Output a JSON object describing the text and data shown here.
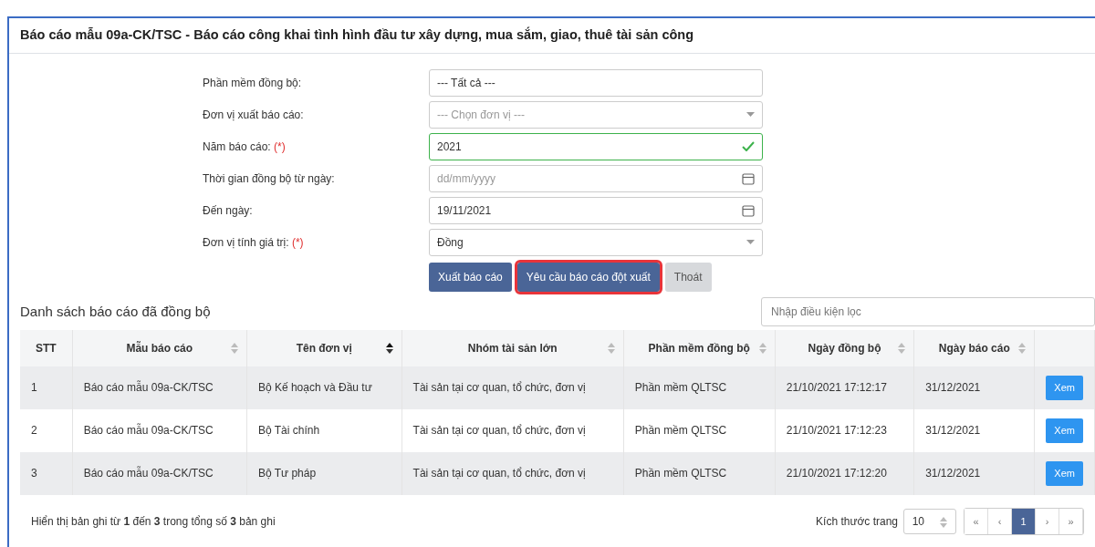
{
  "title": "Báo cáo mẫu 09a-CK/TSC - Báo cáo công khai tình hình đầu tư xây dựng, mua sắm, giao, thuê tài sản công",
  "form": [
    {
      "label": "Phần mềm đồng bộ:",
      "kind": "text",
      "value": "--- Tất cả ---"
    },
    {
      "label": "Đơn vị xuất báo cáo:",
      "kind": "select",
      "placeholder": "--- Chọn đơn vị ---"
    },
    {
      "label": "Năm báo cáo:",
      "required_mark": "(*)",
      "kind": "valid",
      "value": "2021"
    },
    {
      "label": "Thời gian đồng bộ từ ngày:",
      "kind": "date",
      "placeholder": "dd/mm/yyyy"
    },
    {
      "label": "Đến ngày:",
      "kind": "date",
      "value": "19/11/2021"
    },
    {
      "label": "Đơn vị tính giá trị:",
      "required_mark": "(*)",
      "kind": "select",
      "value": "Đồng"
    }
  ],
  "buttons": [
    {
      "label": "Xuất báo cáo",
      "kind": "primary",
      "highlighted": false
    },
    {
      "label": "Yêu cầu báo cáo đột xuất",
      "kind": "primary",
      "highlighted": true
    },
    {
      "label": "Thoát",
      "kind": "secondary",
      "highlighted": false
    }
  ],
  "list_title": "Danh sách báo cáo đã đồng bộ",
  "filter": {
    "placeholder": "Nhập điều kiện lọc"
  },
  "table": {
    "columns": [
      {
        "label": "STT",
        "sortable": false
      },
      {
        "label": "Mẫu báo cáo",
        "sortable": true,
        "sorted": false
      },
      {
        "label": "Tên đơn vị",
        "sortable": true,
        "sorted": true
      },
      {
        "label": "Nhóm tài sản lớn",
        "sortable": true,
        "sorted": false
      },
      {
        "label": "Phần mềm đồng bộ",
        "sortable": true,
        "sorted": false
      },
      {
        "label": "Ngày đồng bộ",
        "sortable": true,
        "sorted": false
      },
      {
        "label": "Ngày báo cáo",
        "sortable": true,
        "sorted": false
      }
    ],
    "rows": [
      {
        "cells": [
          "1",
          "Báo cáo mẫu 09a-CK/TSC",
          "Bộ Kế hoạch và Đầu tư",
          "Tài sản tại cơ quan, tổ chức, đơn vị",
          "Phần mềm QLTSC",
          "21/10/2021 17:12:17",
          "31/12/2021"
        ],
        "action": "Xem"
      },
      {
        "cells": [
          "2",
          "Báo cáo mẫu 09a-CK/TSC",
          "Bộ Tài chính",
          "Tài sản tại cơ quan, tổ chức, đơn vị",
          "Phần mềm QLTSC",
          "21/10/2021 17:12:23",
          "31/12/2021"
        ],
        "action": "Xem"
      },
      {
        "cells": [
          "3",
          "Báo cáo mẫu 09a-CK/TSC",
          "Bộ Tư pháp",
          "Tài sản tại cơ quan, tổ chức, đơn vị",
          "Phần mềm QLTSC",
          "21/10/2021 17:12:20",
          "31/12/2021"
        ],
        "action": "Xem"
      }
    ]
  },
  "footer": {
    "summary": "Hiển thị bản ghi từ **1** đến **3** trong tổng số **3** bản ghi",
    "page_size_label": "Kích thước trang",
    "page_size": "10",
    "pages": [
      {
        "label": "«",
        "selected": false
      },
      {
        "label": "‹",
        "selected": false
      },
      {
        "label": "1",
        "selected": true
      },
      {
        "label": "›",
        "selected": false
      },
      {
        "label": "»",
        "selected": false
      }
    ]
  }
}
